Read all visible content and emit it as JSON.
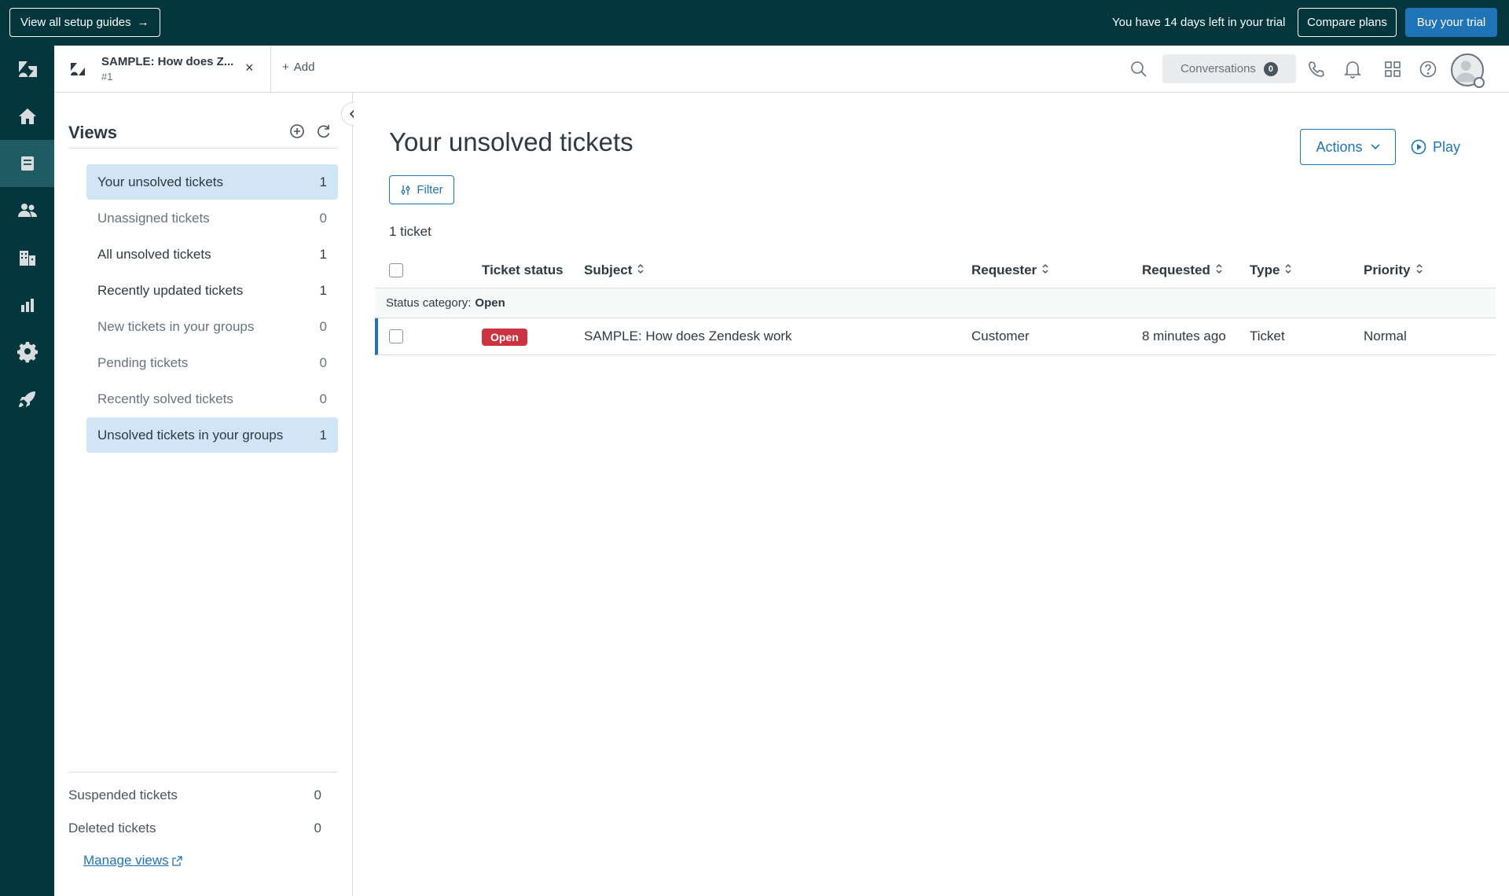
{
  "banner": {
    "guides_label": "View all setup guides",
    "trial_text": "You have 14 days left in your trial",
    "compare_label": "Compare plans",
    "buy_label": "Buy your trial"
  },
  "nav": {
    "items": [
      "logo",
      "home",
      "tickets",
      "customers",
      "organizations",
      "reporting",
      "admin",
      "getting-started"
    ],
    "active": "tickets"
  },
  "header": {
    "tab_title": "SAMPLE: How does Z...",
    "tab_sub": "#1",
    "add_label": "Add",
    "conversations_label": "Conversations",
    "conversations_count": "0"
  },
  "views": {
    "title": "Views",
    "items": [
      {
        "label": "Your unsolved tickets",
        "count": "1"
      },
      {
        "label": "Unassigned tickets",
        "count": "0"
      },
      {
        "label": "All unsolved tickets",
        "count": "1"
      },
      {
        "label": "Recently updated tickets",
        "count": "1"
      },
      {
        "label": "New tickets in your groups",
        "count": "0"
      },
      {
        "label": "Pending tickets",
        "count": "0"
      },
      {
        "label": "Recently solved tickets",
        "count": "0"
      },
      {
        "label": "Unsolved tickets in your groups",
        "count": "1"
      }
    ],
    "suspended": {
      "label": "Suspended tickets",
      "count": "0"
    },
    "deleted": {
      "label": "Deleted tickets",
      "count": "0"
    },
    "manage_label": "Manage views"
  },
  "main": {
    "title": "Your unsolved tickets",
    "actions_label": "Actions",
    "play_label": "Play",
    "filter_label": "Filter",
    "count_text": "1 ticket",
    "columns": {
      "status": "Ticket status",
      "subject": "Subject",
      "requester": "Requester",
      "requested": "Requested",
      "type": "Type",
      "priority": "Priority"
    },
    "group_label": "Status category:",
    "group_value": "Open",
    "row": {
      "status": "Open",
      "subject": "SAMPLE: How does Zendesk work",
      "requester": "Customer",
      "requested": "8 minutes ago",
      "type": "Ticket",
      "priority": "Normal"
    }
  },
  "colors": {
    "brand_dark": "#03363d",
    "accent": "#1f73b7",
    "open_status": "#cc3340",
    "selected_view": "#d2e5f6"
  }
}
